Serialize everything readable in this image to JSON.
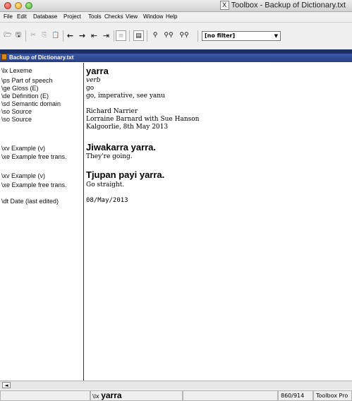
{
  "window": {
    "title": "Toolbox - Backup of Dictionary.txt",
    "icon_glyph": "X"
  },
  "menu": [
    "File",
    "Edit",
    "Database",
    "Project",
    "Tools",
    "Checks",
    "View",
    "Window",
    "Help"
  ],
  "toolbar": {
    "filter_value": "[no filter]",
    "filter_arrow": "▼",
    "glyphs": {
      "open": "🗁",
      "save": "🖫",
      "cut": "✂",
      "copy": "⎘",
      "paste": "📋",
      "prev": "←",
      "next": "→",
      "first": "⇤",
      "last": "⇥",
      "list": "≡",
      "browse": "▤",
      "find": "⚲",
      "find_next": "⚲⚲",
      "find_prev": "⚲⚲"
    }
  },
  "document": {
    "title": "Backup of Dictionary.txt"
  },
  "record": {
    "fields": [
      {
        "label": "\\lx  Lexeme",
        "value": "yarra"
      },
      {
        "label": "\\ps  Part of speech",
        "value": "verb"
      },
      {
        "label": "\\ge  Gloss (E)",
        "value": "go"
      },
      {
        "label": "\\de  Definition (E)",
        "value": "go, imperative, see yanu"
      },
      {
        "label": "\\sd  Semantic domain",
        "value": ""
      },
      {
        "label": "\\so  Source",
        "value": "Richard Narrier"
      },
      {
        "label": "\\so  Source",
        "value": "Lorraine Barnard with Sue Hanson"
      },
      {
        "label": "",
        "value": "Kalgoorlie, 8th May 2013"
      },
      {
        "label": "\\xv  Example (v)",
        "value": "Jiwakarra yarra."
      },
      {
        "label": "\\xe  Example free trans.",
        "value": "They're going."
      },
      {
        "label": "\\xv  Example (v)",
        "value": "Tjupan payi yarra."
      },
      {
        "label": "\\xe  Example free trans.",
        "value": "Go straight."
      },
      {
        "label": "\\dt  Date (last edited)",
        "value": "08/May/2013"
      }
    ]
  },
  "scrollbar": {
    "left_arrow": "◄"
  },
  "status": {
    "marker": "\\lx",
    "value": "yarra",
    "record_position": "860/914",
    "app": "Toolbox Pro"
  }
}
